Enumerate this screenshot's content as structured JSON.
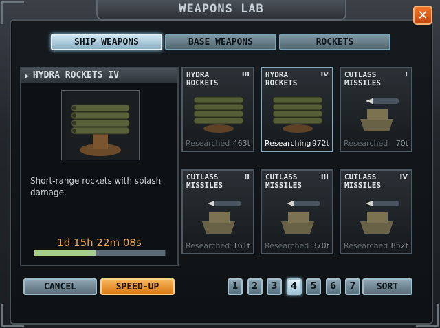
{
  "window": {
    "title": "WEAPONS LAB",
    "close_symbol": "✕"
  },
  "tabs": [
    {
      "label": "SHIP WEAPONS",
      "active": true
    },
    {
      "label": "BASE WEAPONS",
      "active": false
    },
    {
      "label": "ROCKETS",
      "active": false
    }
  ],
  "detail": {
    "title": "HYDRA ROCKETS IV",
    "description": "Short-range rockets with splash damage.",
    "timer": "1d 15h 22m 08s",
    "progress": 0.47
  },
  "cards": [
    {
      "name_line1": "HYDRA",
      "name_line2": "ROCKETS",
      "tier": "III",
      "status": "Researched",
      "cost": "463t",
      "active": false,
      "icon": "rocket-launcher-icon"
    },
    {
      "name_line1": "HYDRA",
      "name_line2": "ROCKETS",
      "tier": "IV",
      "status": "Researching",
      "cost": "972t",
      "active": true,
      "icon": "rocket-launcher-icon"
    },
    {
      "name_line1": "CUTLASS",
      "name_line2": "MISSILES",
      "tier": "I",
      "status": "Researched",
      "cost": "70t",
      "active": false,
      "icon": "missile-turret-icon"
    },
    {
      "name_line1": "CUTLASS",
      "name_line2": "MISSILES",
      "tier": "II",
      "status": "Researched",
      "cost": "161t",
      "active": false,
      "icon": "missile-turret-icon"
    },
    {
      "name_line1": "CUTLASS",
      "name_line2": "MISSILES",
      "tier": "III",
      "status": "Researched",
      "cost": "370t",
      "active": false,
      "icon": "missile-turret-icon"
    },
    {
      "name_line1": "CUTLASS",
      "name_line2": "MISSILES",
      "tier": "IV",
      "status": "Researched",
      "cost": "852t",
      "active": false,
      "icon": "missile-turret-icon"
    }
  ],
  "buttons": {
    "cancel": "CANCEL",
    "speed_up": "SPEED-UP",
    "sort": "SORT"
  },
  "pagination": {
    "pages": [
      "1",
      "2",
      "3",
      "4",
      "5",
      "6",
      "7"
    ],
    "current": "4"
  },
  "colors": {
    "accent_orange": "#f0a650",
    "close_orange": "#e0621d",
    "progress_green": "#a6cf8d",
    "tab_active": "#cfe6f3"
  }
}
